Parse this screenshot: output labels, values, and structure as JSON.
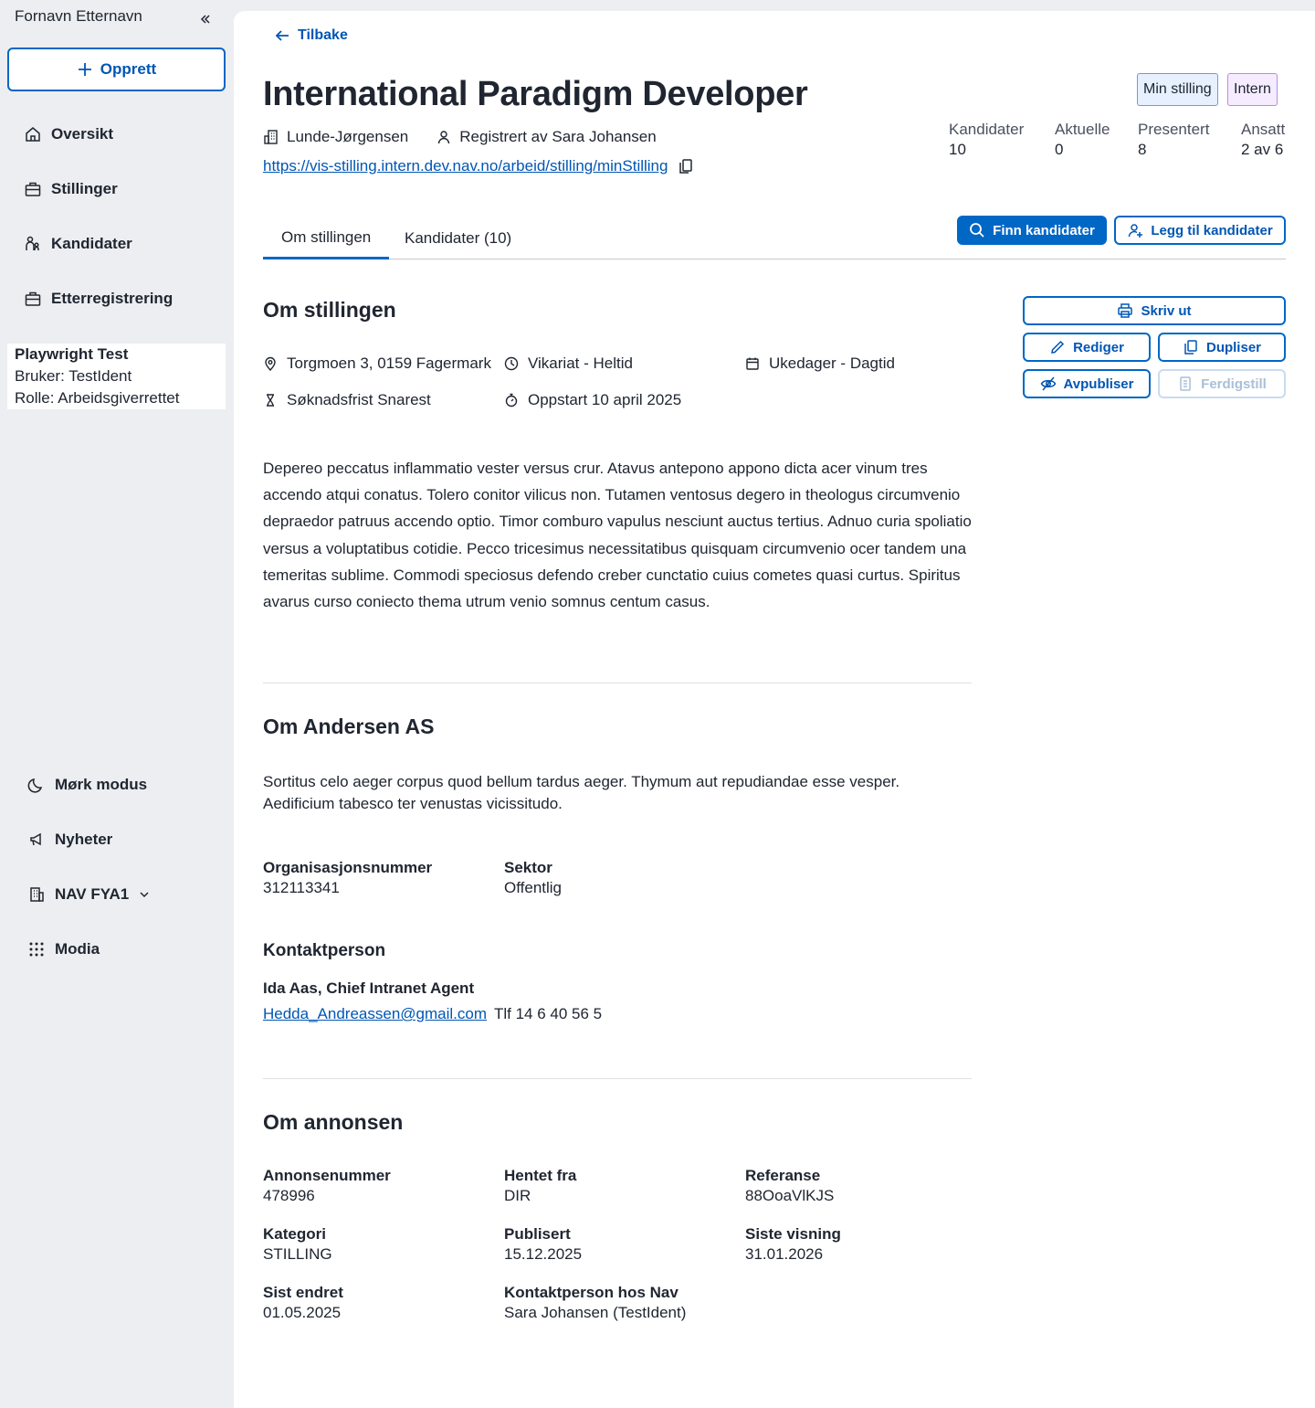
{
  "sidebar": {
    "user_name": "Fornavn Etternavn",
    "create_label": "Opprett",
    "nav": [
      {
        "label": "Oversikt",
        "icon": "house-icon"
      },
      {
        "label": "Stillinger",
        "icon": "briefcase-icon"
      },
      {
        "label": "Kandidater",
        "icon": "people-icon"
      },
      {
        "label": "Etterregistrering",
        "icon": "briefcase-icon"
      }
    ],
    "playwright": {
      "title": "Playwright Test",
      "user": "Bruker: TestIdent",
      "role": "Rolle: Arbeidsgiverrettet"
    },
    "bottom": [
      {
        "label": "Mørk modus",
        "icon": "moon-icon"
      },
      {
        "label": "Nyheter",
        "icon": "megaphone-icon"
      },
      {
        "label": "NAV FYA1",
        "icon": "building-icon"
      },
      {
        "label": "Modia",
        "icon": "grid-icon"
      }
    ]
  },
  "main": {
    "back_label": "Tilbake",
    "title": "International Paradigm Developer",
    "tags": {
      "min": "Min stilling",
      "intern": "Intern"
    },
    "employer": "Lunde-Jørgensen",
    "registered_by": "Registrert av Sara Johansen",
    "url": "https://vis-stilling.intern.dev.nav.no/arbeid/stilling/minStilling",
    "stats": [
      {
        "label": "Kandidater",
        "value": "10"
      },
      {
        "label": "Aktuelle",
        "value": "0"
      },
      {
        "label": "Presentert",
        "value": "8"
      },
      {
        "label": "Ansatt",
        "value": "2 av 6"
      }
    ],
    "tabs": [
      "Om stillingen",
      "Kandidater (10)"
    ],
    "actions": {
      "find": "Finn kandidater",
      "add": "Legg til kandidater",
      "print": "Skriv ut",
      "edit": "Rediger",
      "duplicate": "Dupliser",
      "unpublish": "Avpubliser",
      "complete": "Ferdigstill"
    },
    "about": {
      "heading": "Om stillingen",
      "address": "Torgmoen 3, 0159 Fagermark",
      "type": "Vikariat - Heltid",
      "schedule": "Ukedager - Dagtid",
      "deadline": "Søknadsfrist Snarest",
      "start": "Oppstart 10 april 2025",
      "description": "Depereo peccatus inflammatio vester versus crur. Atavus antepono appono dicta acer vinum tres accendo atqui conatus. Tolero conitor vilicus non. Tutamen ventosus degero in theologus circumvenio depraedor patruus accendo optio. Timor comburo vapulus nesciunt auctus tertius. Adnuo curia spoliatio versus a voluptatibus cotidie. Pecco tricesimus necessitatibus quisquam circumvenio ocer tandem una temeritas sublime. Commodi speciosus defendo creber cunctatio cuius cometes quasi curtus. Spiritus avarus curso coniecto thema utrum venio somnus centum casus."
    },
    "company": {
      "heading": "Om Andersen AS",
      "description": "Sortitus celo aeger corpus quod bellum tardus aeger. Thymum aut repudiandae esse vesper. Aedificium tabesco ter venustas vicissitudo.",
      "org_label": "Organisasjonsnummer",
      "org_value": "312113341",
      "sector_label": "Sektor",
      "sector_value": "Offentlig",
      "contact_heading": "Kontaktperson",
      "contact_name": "Ida Aas, Chief Intranet Agent",
      "contact_email": "Hedda_Andreassen@gmail.com",
      "contact_phone": "Tlf 14 6 40 56 5"
    },
    "ad": {
      "heading": "Om annonsen",
      "fields": [
        {
          "label": "Annonsenummer",
          "value": "478996"
        },
        {
          "label": "Hentet fra",
          "value": "DIR"
        },
        {
          "label": "Referanse",
          "value": "88OoaVlKJS"
        },
        {
          "label": "Kategori",
          "value": "STILLING"
        },
        {
          "label": "Publisert",
          "value": "15.12.2025"
        },
        {
          "label": "Siste visning",
          "value": "31.01.2026"
        },
        {
          "label": "Sist endret",
          "value": "01.05.2025"
        },
        {
          "label": "Kontaktperson hos Nav",
          "value": "Sara Johansen (TestIdent)"
        }
      ]
    }
  }
}
